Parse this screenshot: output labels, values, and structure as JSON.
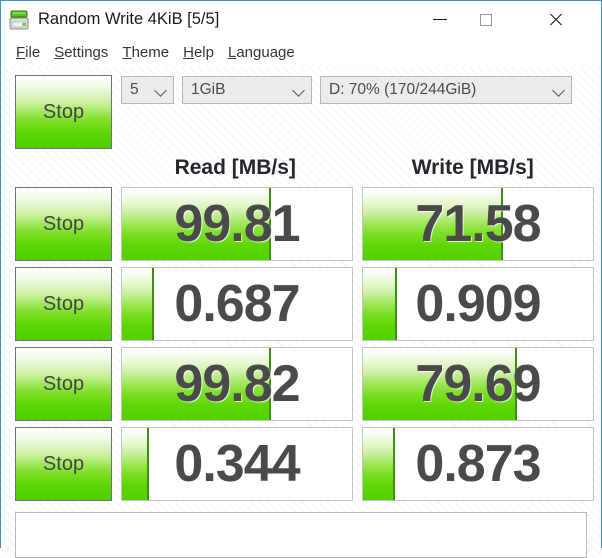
{
  "window": {
    "title": "Random Write 4KiB [5/5]",
    "icon": "disk-drive-icon",
    "accent_color": "#3a8fd4",
    "controls": {
      "minimize": "minimize-icon",
      "maximize": "maximize-icon",
      "close": "close-icon"
    }
  },
  "menubar": {
    "items": [
      {
        "acc": "F",
        "rest": "ile"
      },
      {
        "acc": "S",
        "rest": "ettings"
      },
      {
        "acc": "T",
        "rest": "heme"
      },
      {
        "acc": "H",
        "rest": "elp"
      },
      {
        "acc": "L",
        "rest": "anguage"
      }
    ]
  },
  "toolbar": {
    "stop_label": "Stop",
    "test_count": "5",
    "test_size": "1GiB",
    "target_drive": "D: 70% (170/244GiB)",
    "chevron": "chevron-down-icon"
  },
  "headers": {
    "read": "Read [MB/s]",
    "write": "Write [MB/s]"
  },
  "rows": [
    {
      "stop": "Stop",
      "read": "99.81",
      "read_pct": 64,
      "write": "71.58",
      "write_pct": 60
    },
    {
      "stop": "Stop",
      "read": "0.687",
      "read_pct": 13,
      "write": "0.909",
      "write_pct": 14
    },
    {
      "stop": "Stop",
      "read": "99.82",
      "read_pct": 64,
      "write": "79.69",
      "write_pct": 66
    },
    {
      "stop": "Stop",
      "read": "0.344",
      "read_pct": 11,
      "write": "0.873",
      "write_pct": 13
    }
  ],
  "comment": {
    "value": "",
    "placeholder": ""
  },
  "colors": {
    "bar_green": "#5ed604",
    "bar_edge": "#3f8f15",
    "accent": "#3a8fd4"
  }
}
